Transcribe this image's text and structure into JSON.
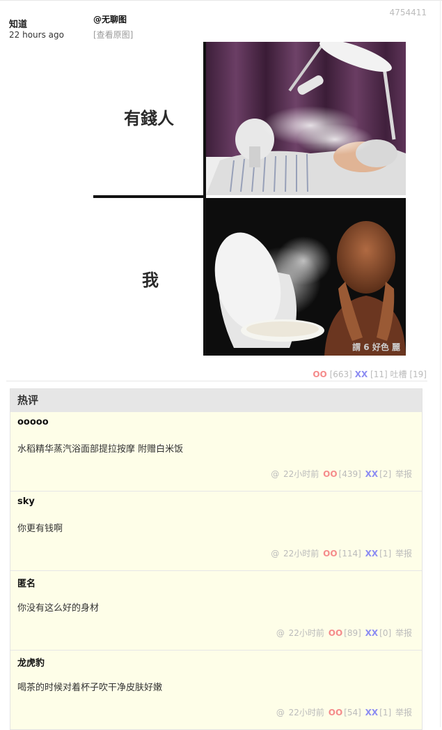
{
  "post": {
    "author": "知道",
    "time": "22 hours ago",
    "id": "4754411",
    "mention": "@无聊图",
    "view_original": "[查看原图]",
    "meme": {
      "label_top": "有錢人",
      "label_bottom": "我",
      "watermark": "謂 6 好色 麗"
    },
    "votes": {
      "oo_symbol": "OO",
      "oo_count": "[663]",
      "xx_symbol": "XX",
      "xx_count": "[11]",
      "tucao_label": "吐槽",
      "tucao_count": "[19]"
    }
  },
  "hot": {
    "title": "热评",
    "comments": [
      {
        "name": "ooooo",
        "text": "水稻精华蒸汽浴面部提拉按摩 附赠白米饭",
        "at": "@",
        "time": "22小时前",
        "oo": "OO",
        "oo_count": "[439]",
        "xx": "XX",
        "xx_count": "[2]",
        "report": "举报"
      },
      {
        "name": "sky",
        "text": "你更有钱啊",
        "at": "@",
        "time": "22小时前",
        "oo": "OO",
        "oo_count": "[114]",
        "xx": "XX",
        "xx_count": "[1]",
        "report": "举报"
      },
      {
        "name": "匿名",
        "text": "你没有这么好的身材",
        "at": "@",
        "time": "22小时前",
        "oo": "OO",
        "oo_count": "[89]",
        "xx": "XX",
        "xx_count": "[0]",
        "report": "举报"
      },
      {
        "name": "龙虎豹",
        "text": "喝茶的时候对着杯子吹干净皮肤好嫩",
        "at": "@",
        "time": "22小时前",
        "oo": "OO",
        "oo_count": "[54]",
        "xx": "XX",
        "xx_count": "[1]",
        "report": "举报"
      }
    ]
  }
}
